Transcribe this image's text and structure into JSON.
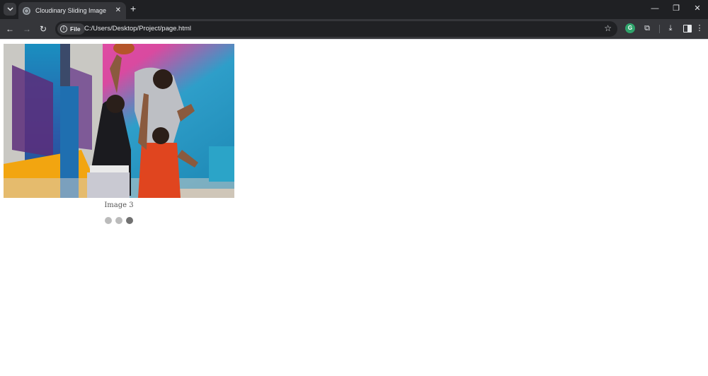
{
  "browser": {
    "tab": {
      "title": "Cloudinary Sliding Image",
      "close_glyph": "✕"
    },
    "new_tab_glyph": "+",
    "window_controls": {
      "minimize": "—",
      "restore": "❐",
      "close": "✕"
    },
    "nav": {
      "back": "←",
      "forward": "→",
      "reload": "↻"
    },
    "address": {
      "scheme_label": "File",
      "url": "C:/Users/Desktop/Project/page.html"
    },
    "icons": {
      "bookmark": "star-icon",
      "grammarly": "G",
      "extensions": "puzzle-icon",
      "downloads": "download-icon",
      "side_panel": "side-panel-icon",
      "menu": "kebab-menu-icon"
    }
  },
  "slider": {
    "caption": "Image 3",
    "dot_count": 3,
    "active_index": 2,
    "image_description_icon": "photo-basketball"
  },
  "colors": {
    "dot_inactive": "#bbbbbb",
    "dot_active": "#717171",
    "tab_bg": "#35363a",
    "frame_bg": "#1f2023"
  }
}
